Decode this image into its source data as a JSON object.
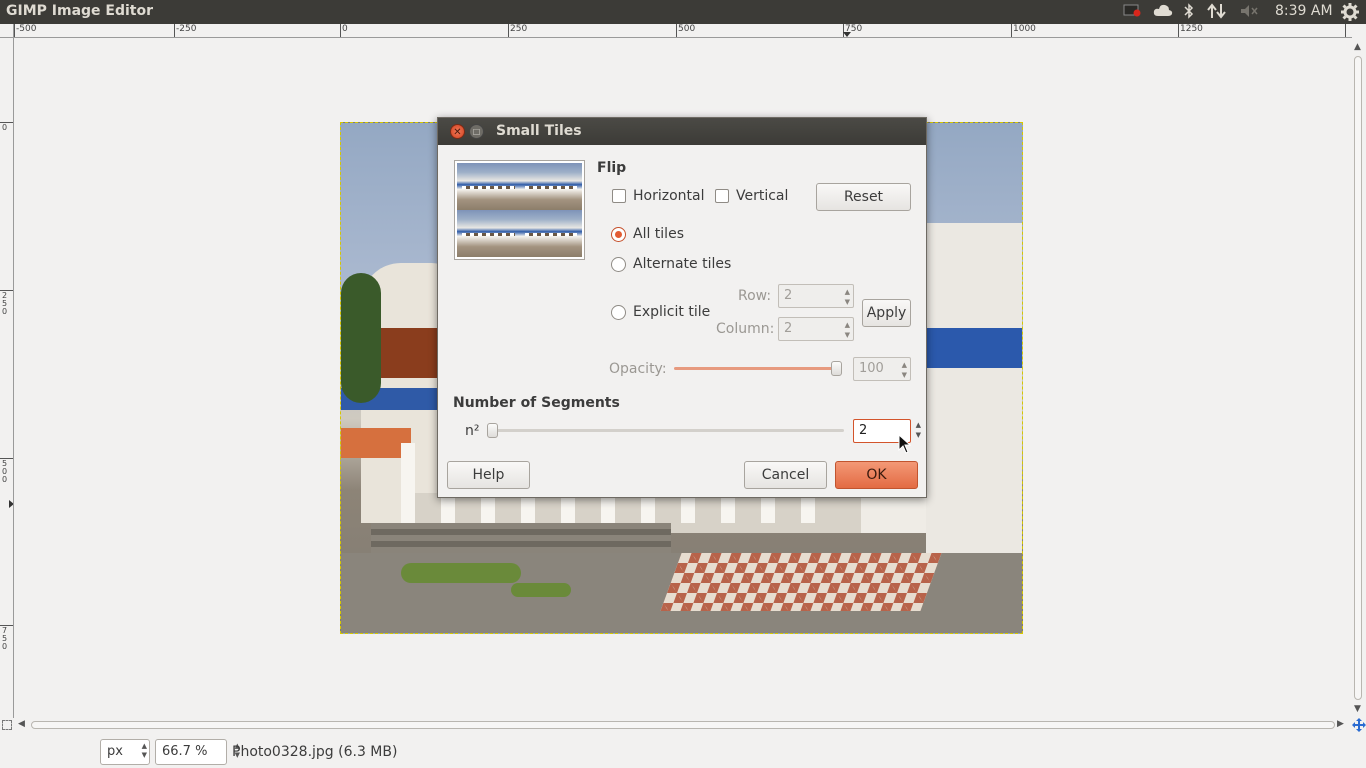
{
  "panel": {
    "app_title": "GIMP Image Editor",
    "clock": "8:39 AM",
    "tray_icons": [
      "recording-indicator-icon",
      "cloud-icon",
      "bluetooth-icon",
      "network-icon",
      "volume-muted-icon",
      "gear-icon"
    ]
  },
  "rulers": {
    "horizontal_labels": [
      "-500",
      "-250",
      "0",
      "250",
      "500",
      "750",
      "1000",
      "1250"
    ],
    "vertical_labels": [
      "0",
      "250",
      "500",
      "750"
    ]
  },
  "statusbar": {
    "unit": "px",
    "zoom": "66.7 %",
    "file_info": "Photo0328.jpg (6.3 MB)"
  },
  "dialog": {
    "title": "Small Tiles",
    "flip_section": "Flip",
    "horizontal_label": "Horizontal",
    "horizontal_checked": false,
    "vertical_label": "Vertical",
    "vertical_checked": false,
    "reset_label": "Reset",
    "all_tiles_label": "All tiles",
    "alternate_tiles_label": "Alternate tiles",
    "explicit_tile_label": "Explicit tile",
    "selected_mode": "All tiles",
    "row_label": "Row:",
    "row_value": "2",
    "column_label": "Column:",
    "column_value": "2",
    "apply_label": "Apply",
    "opacity_label": "Opacity:",
    "opacity_value": "100",
    "segments_section": "Number of Segments",
    "segments_label": "n²",
    "segments_value": "2",
    "help_label": "Help",
    "cancel_label": "Cancel",
    "ok_label": "OK"
  },
  "colors": {
    "accent": "#e36b43",
    "panel_bg": "#3c3b37",
    "window_bg": "#f2f1f0"
  }
}
